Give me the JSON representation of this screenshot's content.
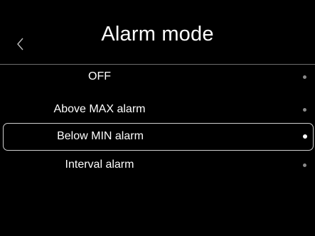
{
  "header": {
    "title": "Alarm mode",
    "back_icon": "chevron-left-icon"
  },
  "options": [
    {
      "label": "OFF",
      "selected": false
    },
    {
      "label": "Above MAX alarm",
      "selected": false
    },
    {
      "label": "Below MIN alarm",
      "selected": true
    },
    {
      "label": "Interval alarm",
      "selected": false
    }
  ],
  "colors": {
    "background": "#000000",
    "text": "#ffffff",
    "divider": "#6d6d6d",
    "dot_inactive": "#8a8a8a",
    "dot_active": "#ffffff",
    "selection_border": "#cfcfcf"
  }
}
